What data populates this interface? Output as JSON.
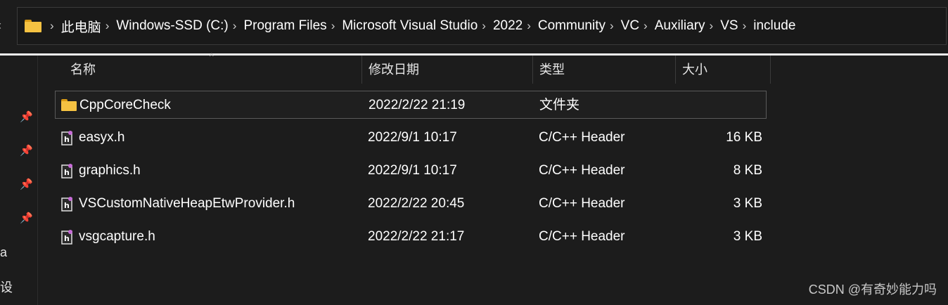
{
  "address": {
    "crumbs": [
      "此电脑",
      "Windows-SSD (C:)",
      "Program Files",
      "Microsoft Visual Studio",
      "2022",
      "Community",
      "VC",
      "Auxiliary",
      "VS",
      "include"
    ],
    "separator": "›"
  },
  "columns": {
    "name": "名称",
    "date": "修改日期",
    "type": "类型",
    "size": "大小"
  },
  "files": [
    {
      "name": "CppCoreCheck",
      "date": "2022/2/22 21:19",
      "type": "文件夹",
      "size": "",
      "icon": "folder-icon"
    },
    {
      "name": "easyx.h",
      "date": "2022/9/1 10:17",
      "type": "C/C++ Header",
      "size": "16 KB",
      "icon": "header-file-icon"
    },
    {
      "name": "graphics.h",
      "date": "2022/9/1 10:17",
      "type": "C/C++ Header",
      "size": "8 KB",
      "icon": "header-file-icon"
    },
    {
      "name": "VSCustomNativeHeapEtwProvider.h",
      "date": "2022/2/22 20:45",
      "type": "C/C++ Header",
      "size": "3 KB",
      "icon": "header-file-icon"
    },
    {
      "name": "vsgcapture.h",
      "date": "2022/2/22 21:17",
      "type": "C/C++ Header",
      "size": "3 KB",
      "icon": "header-file-icon"
    }
  ],
  "nav": {
    "partial_text_1": "a",
    "partial_text_2": "设"
  },
  "watermark": "CSDN @有奇妙能力吗",
  "colors": {
    "background": "#1c1c1c",
    "folder": "#f5c242",
    "text": "#ffffff"
  }
}
